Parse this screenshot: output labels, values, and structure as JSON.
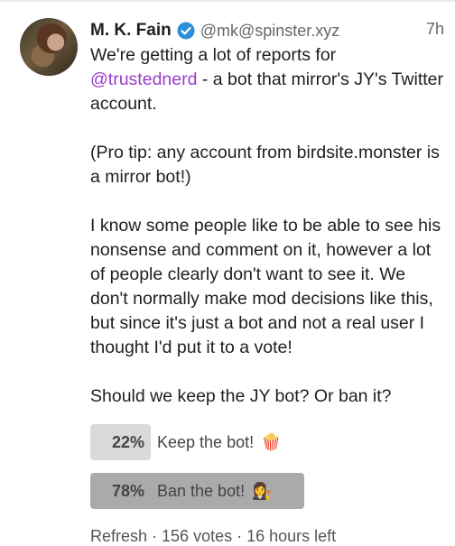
{
  "post": {
    "display_name": "M. K. Fain",
    "handle": "@mk@spinster.xyz",
    "time": "7h",
    "text": {
      "p1_before": "We're getting a lot of reports for ",
      "mention": "@trustednerd",
      "p1_after": " - a bot that mirror's JY's Twitter account.",
      "p2": "(Pro tip: any account from birdsite.monster is a mirror bot!)",
      "p3": "I know some people like to be able to see his nonsense and comment on it, however a lot of people clearly don't want to see it. We don't normally make mod decisions like this, but since it's just a bot and not a real user I thought I'd put it to a vote!",
      "p4": "Should we keep the JY bot? Or ban it?"
    }
  },
  "poll": {
    "options": [
      {
        "percent_label": "22%",
        "percent": 22,
        "label": "Keep the bot!",
        "emoji": "🍿",
        "winner": false
      },
      {
        "percent_label": "78%",
        "percent": 78,
        "label": "Ban the bot!",
        "emoji": "👩‍⚖️",
        "winner": true
      }
    ],
    "footer": {
      "refresh": "Refresh",
      "sep": " · ",
      "votes": "156 votes",
      "time_left": "16 hours left"
    }
  },
  "colors": {
    "mention": "#9b3dc8",
    "verified": "#2b90d9",
    "poll_fill": "#d9d9d9",
    "poll_fill_winner": "#aaaaaa"
  },
  "icons": {
    "verified": "verified-check-icon"
  }
}
